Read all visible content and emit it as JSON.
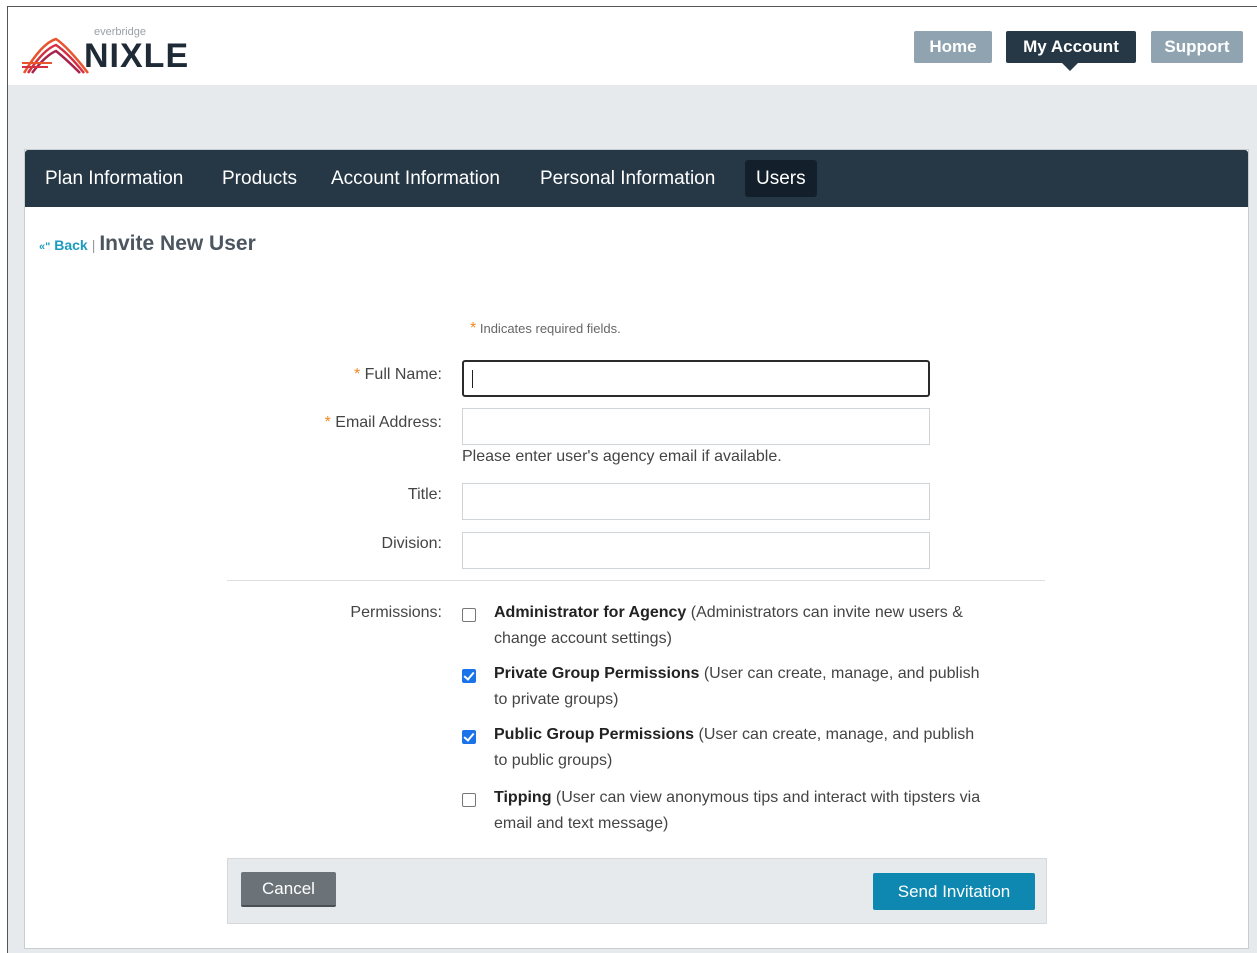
{
  "brand": {
    "small": "everbridge",
    "name": "NIXLE"
  },
  "topnav": {
    "home": "Home",
    "my_account": "My Account",
    "support": "Support"
  },
  "tabs": [
    {
      "label": "Plan Information"
    },
    {
      "label": "Products"
    },
    {
      "label": "Account Information"
    },
    {
      "label": "Personal Information"
    },
    {
      "label": "Users",
      "active": true
    }
  ],
  "header": {
    "back": "Back",
    "separator": "|",
    "title": "Invite New User"
  },
  "form": {
    "required_note": "Indicates required fields.",
    "required_mark": "*",
    "full_name": {
      "label": "Full Name:",
      "value": ""
    },
    "email": {
      "label": "Email Address:",
      "value": "",
      "hint": "Please enter user's agency email if available."
    },
    "title": {
      "label": "Title:",
      "value": ""
    },
    "division": {
      "label": "Division:",
      "value": ""
    },
    "permissions": {
      "label": "Permissions:",
      "items": [
        {
          "bold": "Administrator for Agency",
          "line1": " (Administrators can invite new users &",
          "line2": "change account settings)",
          "checked": false
        },
        {
          "bold": "Private Group Permissions",
          "line1": " (User can create, manage, and publish",
          "line2": "to private groups)",
          "checked": true
        },
        {
          "bold": "Public Group Permissions",
          "line1": " (User can create, manage, and publish",
          "line2": "to public groups)",
          "checked": true
        },
        {
          "bold": "Tipping",
          "line1": " (User can view anonymous tips and interact with tipsters via",
          "line2": "email and text message)",
          "checked": false
        }
      ]
    }
  },
  "actions": {
    "cancel": "Cancel",
    "send": "Send Invitation"
  },
  "colors": {
    "navy": "#263746",
    "accent": "#0e88b0",
    "link": "#1a9bbf",
    "required": "#f08a24"
  }
}
